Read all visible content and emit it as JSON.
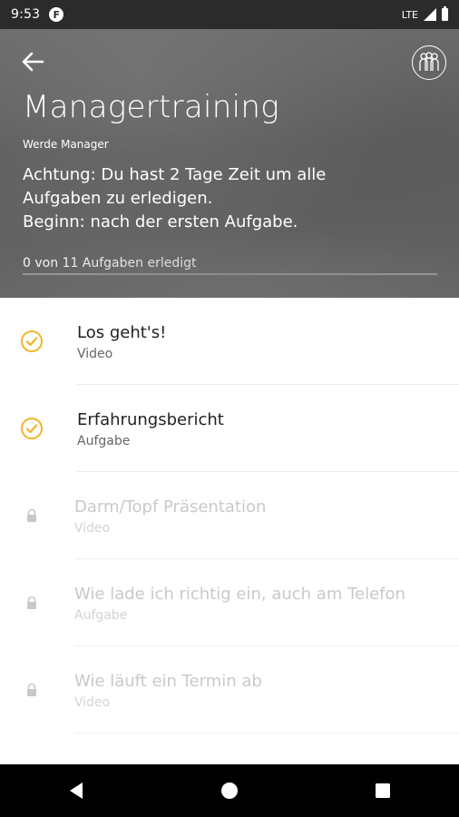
{
  "status_bar": {
    "time": "9:53",
    "notification_badge": "F",
    "network": "LTE"
  },
  "header": {
    "title": "Managertraining",
    "subtitle": "Werde Manager",
    "notice": "Achtung: Du hast 2 Tage Zeit um alle\nAufgaben zu erledigen.\nBeginn: nach der ersten Aufgabe.",
    "progress_text": "0 von 11 Aufgaben erledigt",
    "progress_fraction": 0
  },
  "tasks": [
    {
      "title": "Los geht's!",
      "type": "Video",
      "state": "done"
    },
    {
      "title": "Erfahrungsbericht",
      "type": "Aufgabe",
      "state": "done"
    },
    {
      "title": "Darm/Topf Präsentation",
      "type": "Video",
      "state": "locked"
    },
    {
      "title": "Wie lade ich richtig ein, auch am Telefon",
      "type": "Aufgabe",
      "state": "locked"
    },
    {
      "title": "Wie läuft ein Termin ab",
      "type": "Video",
      "state": "locked"
    },
    {
      "title": "",
      "type": "",
      "state": "locked"
    }
  ],
  "colors": {
    "accent": "#f5b324",
    "header_bg": "#5f5f5f",
    "locked_text": "#c9c9c9"
  },
  "icons": {
    "back": "arrow-left-icon",
    "team": "team-icon",
    "done": "check-circle-icon",
    "locked": "lock-icon",
    "nav": [
      "back-triangle-icon",
      "home-circle-icon",
      "recents-square-icon"
    ]
  }
}
